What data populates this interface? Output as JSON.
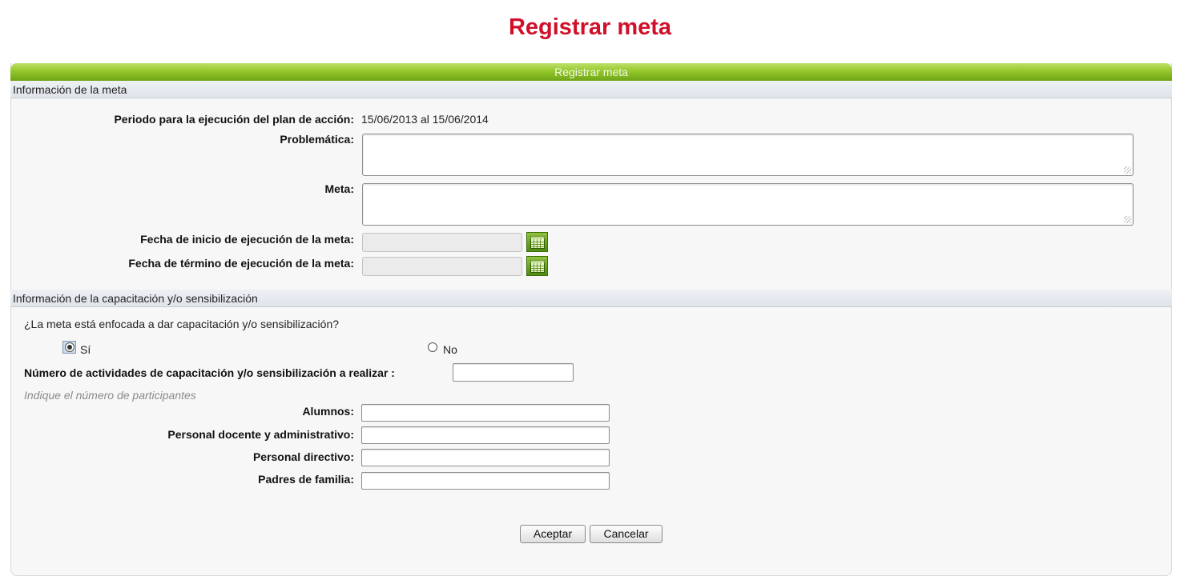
{
  "page_title": "Registrar meta",
  "panel_title": "Registrar meta",
  "section_meta": {
    "title": "Información de la meta",
    "periodo_label": "Periodo para la ejecución del plan de acción:",
    "periodo_value": "15/06/2013 al 15/06/2014",
    "problematica_label": "Problemática:",
    "problematica_value": "",
    "meta_label": "Meta:",
    "meta_value": "",
    "fecha_inicio_label": "Fecha de inicio de ejecución de la meta:",
    "fecha_termino_label": "Fecha de término de ejecución de la meta:"
  },
  "section_capacitacion": {
    "title": "Información de la capacitación y/o sensibilización",
    "question": "¿La meta está enfocada a dar capacitación y/o sensibilización?",
    "option_si": "Sí",
    "option_no": "No",
    "selected_option": "Sí",
    "num_actividades_label": "Número de actividades de capacitación y/o sensibilización a realizar :",
    "participantes_hint": "Indique el número de participantes",
    "alumnos_label": "Alumnos:",
    "personal_docente_label": "Personal docente y administrativo:",
    "personal_directivo_label": "Personal directivo:",
    "padres_label": "Padres de familia:"
  },
  "buttons": {
    "aceptar": "Aceptar",
    "cancelar": "Cancelar"
  },
  "colors": {
    "title_red": "#d0102a",
    "header_green": "#94c72a"
  }
}
